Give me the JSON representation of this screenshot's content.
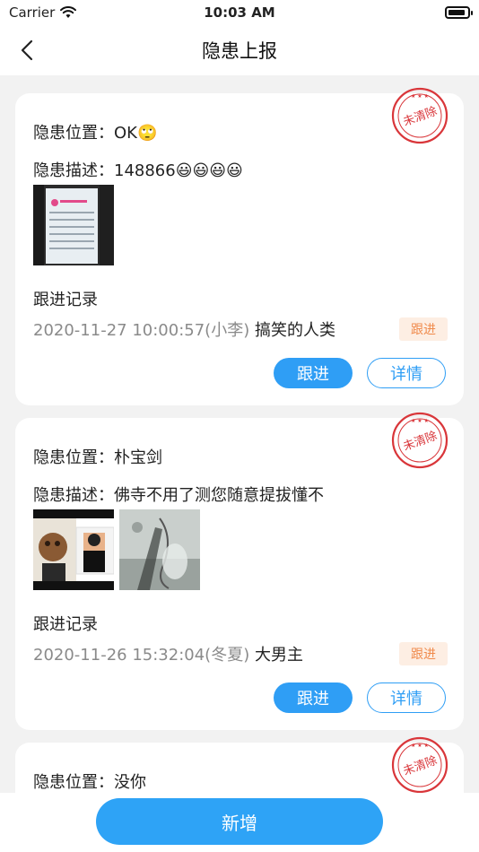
{
  "status_bar": {
    "carrier": "Carrier",
    "time": "10:03 AM",
    "battery_level": 0.9
  },
  "nav": {
    "title": "隐患上报"
  },
  "cards": [
    {
      "location_label": "隐患位置：",
      "location_value": "OK🙄",
      "desc_label": "隐患描述：",
      "desc_value": "148866😃😃😃😃",
      "stamp_text": "未清除",
      "record_title": "跟进记录",
      "record_time": "2020-11-27 10:00:57(小李)",
      "record_text": "搞笑的人类",
      "tag": "跟进",
      "follow_button": "跟进",
      "detail_button": "详情"
    },
    {
      "location_label": "隐患位置：",
      "location_value": "朴宝剑",
      "desc_label": "隐患描述：",
      "desc_value": "佛寺不用了测您随意提拔懂不",
      "stamp_text": "未清除",
      "record_title": "跟进记录",
      "record_time": "2020-11-26 15:32:04(冬夏)",
      "record_text": "大男主",
      "tag": "跟进",
      "follow_button": "跟进",
      "detail_button": "详情"
    },
    {
      "location_label": "隐患位置：",
      "location_value": "没你",
      "stamp_text": "未清除"
    }
  ],
  "bottom": {
    "add_button": "新增"
  },
  "colors": {
    "primary": "#2f9ef5",
    "stamp": "#d9363a",
    "tag_bg": "#fdeee3",
    "tag_text": "#f08a4b"
  }
}
